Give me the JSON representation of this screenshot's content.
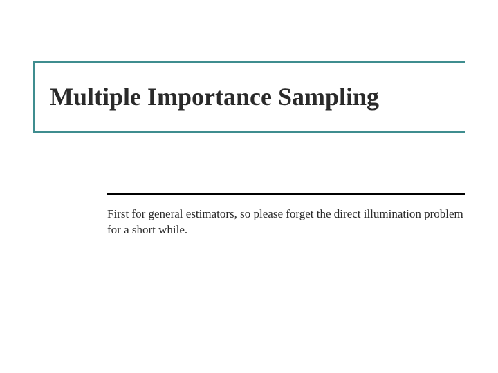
{
  "slide": {
    "title": "Multiple Importance Sampling",
    "subtitle": "First for general estimators, so please forget the direct illumination problem for a short while."
  }
}
